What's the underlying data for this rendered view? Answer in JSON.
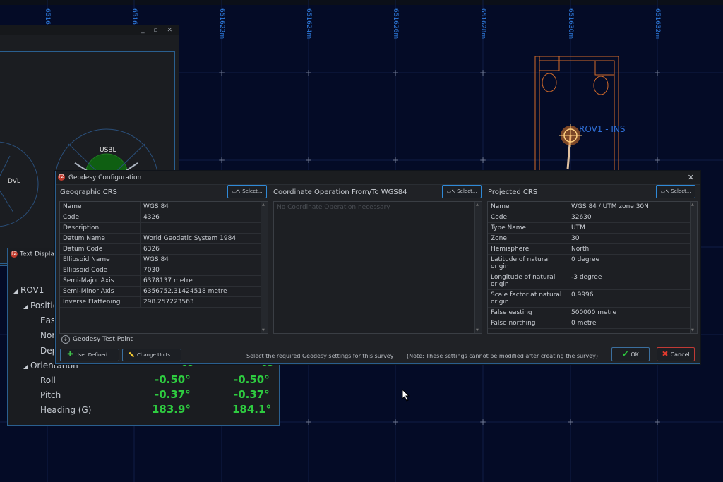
{
  "map": {
    "grid_labels": [
      "6516",
      "6516",
      "651622m",
      "651624m",
      "651626m",
      "651628m",
      "651630m",
      "651632m"
    ],
    "vehicle_label": "ROV1 - INS"
  },
  "sensor_window": {
    "dvl_label": "DVL",
    "usbl_label": "USBL"
  },
  "text_display": {
    "title": "Text Display",
    "tree": {
      "root": "ROV1",
      "position": "Positio",
      "easting": "East",
      "northing": "Nort",
      "depth": "Dep",
      "orientation": "Orientation",
      "roll": "Roll",
      "pitch": "Pitch",
      "heading": "Heading (G)"
    },
    "col_headers": [
      "US",
      "US"
    ],
    "roll": [
      "-0.50°",
      "-0.50°"
    ],
    "pitch": [
      "-0.37°",
      "-0.37°"
    ],
    "heading": [
      "183.9°",
      "184.1°"
    ]
  },
  "dialog": {
    "title": "Geodesy Configuration",
    "select_label": "Select...",
    "geographic": {
      "title": "Geographic CRS",
      "rows": [
        {
          "k": "Name",
          "v": "WGS 84"
        },
        {
          "k": "Code",
          "v": "4326"
        },
        {
          "k": "Description",
          "v": ""
        },
        {
          "k": "Datum Name",
          "v": "World Geodetic System 1984"
        },
        {
          "k": "Datum Code",
          "v": "6326"
        },
        {
          "k": "Ellipsoid Name",
          "v": "WGS 84"
        },
        {
          "k": "Ellipsoid Code",
          "v": "7030"
        },
        {
          "k": "Semi-Major Axis",
          "v": "6378137 metre"
        },
        {
          "k": "Semi-Minor Axis",
          "v": "6356752.31424518 metre"
        },
        {
          "k": "Inverse Flattening",
          "v": "298.257223563"
        }
      ]
    },
    "coordinate_op": {
      "title": "Coordinate Operation From/To WGS84",
      "empty_text": "No Coordinate Operation necessary"
    },
    "projected": {
      "title": "Projected CRS",
      "rows": [
        {
          "k": "Name",
          "v": "WGS 84 / UTM zone 30N"
        },
        {
          "k": "Code",
          "v": "32630"
        },
        {
          "k": "Type Name",
          "v": "UTM"
        },
        {
          "k": "Zone",
          "v": "30"
        },
        {
          "k": "Hemisphere",
          "v": "North"
        },
        {
          "k": "Latitude of natural origin",
          "v": "0 degree"
        },
        {
          "k": "Longitude of natural origin",
          "v": "-3 degree"
        },
        {
          "k": "Scale factor at natural origin",
          "v": "0.9996"
        },
        {
          "k": "False easting",
          "v": "500000 metre"
        },
        {
          "k": "False northing",
          "v": "0 metre"
        }
      ]
    },
    "test_point_label": "Geodesy Test Point",
    "user_defined_label": "User Defined...",
    "change_units_label": "Change Units...",
    "instruction": "Select the required Geodesy settings for this survey",
    "note": "(Note: These settings cannot be modified after creating the survey)",
    "ok_label": "OK",
    "cancel_label": "Cancel"
  },
  "colors": {
    "accent": "#2f8ad8",
    "value_green": "#2ecc40",
    "background": "#040b26",
    "vehicle_orange": "#e07a2a"
  }
}
